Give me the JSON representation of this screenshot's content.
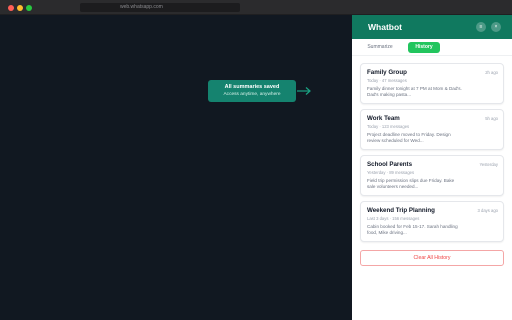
{
  "browser": {
    "url": "web.whatsapp.com"
  },
  "callout": {
    "title": "All summaries saved",
    "subtitle": "Access anytime, anywhere"
  },
  "panel": {
    "title": "Whatbot",
    "menu_icon": "≡",
    "close_icon": "×",
    "tabs": [
      {
        "label": "Summarize",
        "active": false
      },
      {
        "label": "History",
        "active": true
      }
    ],
    "history": [
      {
        "name": "Family Group",
        "time": "2h ago",
        "meta": "Today · 47 messages",
        "snippet": "Family dinner tonight at 7 PM at Mom & Dad's. Dad's making pasta..."
      },
      {
        "name": "Work Team",
        "time": "5h ago",
        "meta": "Today · 123 messages",
        "snippet": "Project deadline moved to Friday. Design review scheduled for Wed..."
      },
      {
        "name": "School Parents",
        "time": "Yesterday",
        "meta": "Yesterday · 89 messages",
        "snippet": "Field trip permission slips due Friday. Bake sale volunteers needed..."
      },
      {
        "name": "Weekend Trip Planning",
        "time": "3 days ago",
        "meta": "Last 3 days · 156 messages",
        "snippet": "Cabin booked for Feb 15-17. Sarah handling food, Mike driving..."
      }
    ],
    "clear_label": "Clear All History"
  },
  "colors": {
    "brand": "#10795f",
    "accent": "#22c55e",
    "danger": "#ef4444"
  }
}
